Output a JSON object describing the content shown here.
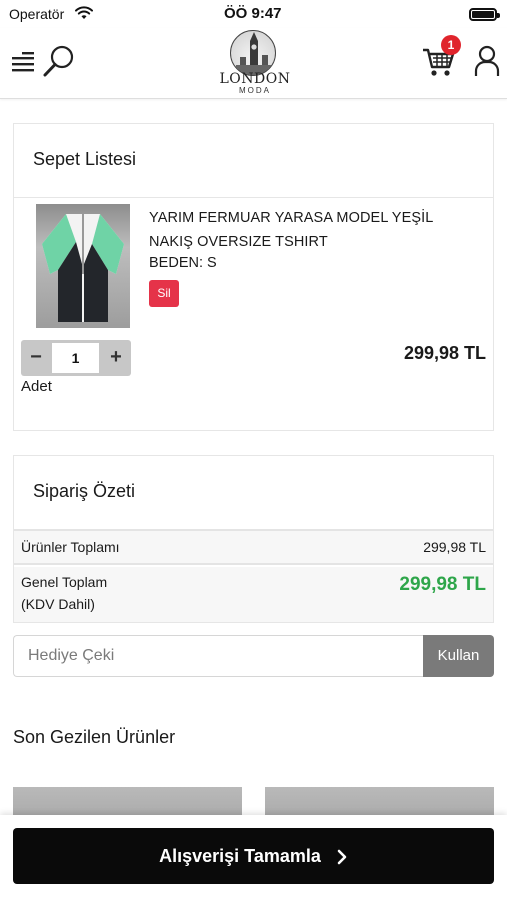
{
  "status_bar": {
    "carrier": "Operatör",
    "time": "ÖÖ 9:47"
  },
  "header": {
    "logo_text": "LONDON",
    "logo_subtext": "MODA",
    "cart_count": "1",
    "icons": [
      "menu-icon",
      "search-icon",
      "cart-icon",
      "user-icon"
    ]
  },
  "cart": {
    "title": "Sepet Listesi",
    "item": {
      "name": "YARIM FERMUAR YARASA MODEL YEŞİL NAKIŞ OVERSIZE TSHIRT",
      "size": "BEDEN: S",
      "remove_label": "Sil",
      "quantity": "1",
      "minus_label": "−",
      "plus_label": "+",
      "quantity_label": "Adet",
      "price": "299,98 TL"
    }
  },
  "summary": {
    "title": "Sipariş Özeti",
    "subtotal_label": "Ürünler Toplamı",
    "subtotal_value": "299,98 TL",
    "total_label_line1": "Genel Toplam",
    "total_label_line2": "(KDV Dahil)",
    "total_value": "299,98 TL"
  },
  "coupon": {
    "placeholder": "Hediye Çeki",
    "value": "",
    "button_label": "Kullan"
  },
  "recent": {
    "title": "Son Gezilen Ürünler"
  },
  "checkout": {
    "label": "Alışverişi Tamamla"
  },
  "colors": {
    "remove_button": "#e53349",
    "badge": "#e0242c",
    "total_price": "#2ea64a",
    "checkout_button": "#0a0a0a",
    "coupon_button": "#7a7a7a"
  }
}
